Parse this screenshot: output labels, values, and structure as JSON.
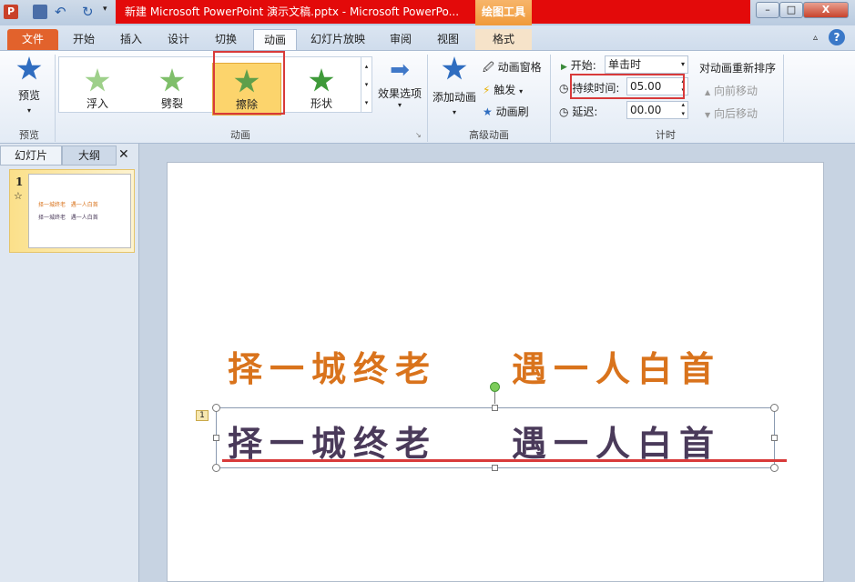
{
  "window": {
    "title": "新建 Microsoft PowerPoint 演示文稿.pptx - Microsoft PowerPo...",
    "context_tool": "绘图工具",
    "minimize": "–",
    "maximize": "□",
    "close": "X"
  },
  "tabs": [
    {
      "label": "文件"
    },
    {
      "label": "开始"
    },
    {
      "label": "插入"
    },
    {
      "label": "设计"
    },
    {
      "label": "切换"
    },
    {
      "label": "动画"
    },
    {
      "label": "幻灯片放映"
    },
    {
      "label": "审阅"
    },
    {
      "label": "视图"
    },
    {
      "label": "格式"
    }
  ],
  "ribbon": {
    "preview": {
      "label": "预览",
      "group": "预览"
    },
    "animations": [
      {
        "label": "浮入"
      },
      {
        "label": "劈裂"
      },
      {
        "label": "擦除"
      },
      {
        "label": "形状"
      }
    ],
    "effect_options": "效果选项",
    "animation_group": "动画",
    "add_animation": "添加动画",
    "animation_pane": "动画窗格",
    "trigger": "触发",
    "animation_painter": "动画刷",
    "advanced_group": "高级动画",
    "start_label": "开始:",
    "start_value": "单击时",
    "duration_label": "持续时间:",
    "duration_value": "05.00",
    "delay_label": "延迟:",
    "delay_value": "00.00",
    "timing_group": "计时",
    "reorder_title": "对动画重新排序",
    "move_earlier": "向前移动",
    "move_later": "向后移动"
  },
  "left_panel": {
    "tabs": [
      "幻灯片",
      "大纲"
    ],
    "close": "✕",
    "slide_number": "1",
    "anim_marker": "☆",
    "thumb_lines": [
      "择一城终老   遇一人白首",
      "择一城终老   遇一人白首"
    ]
  },
  "slide": {
    "line1_left": "择一城终老",
    "line1_right": "遇一人白首",
    "line2_left": "择一城终老",
    "line2_right": "遇一人白首",
    "anim_tag": "1"
  },
  "colors": {
    "orange": "#d9731c",
    "purple": "#4a3a5a",
    "highlight": "#d83a3a",
    "accent_tab": "#e2622c"
  }
}
